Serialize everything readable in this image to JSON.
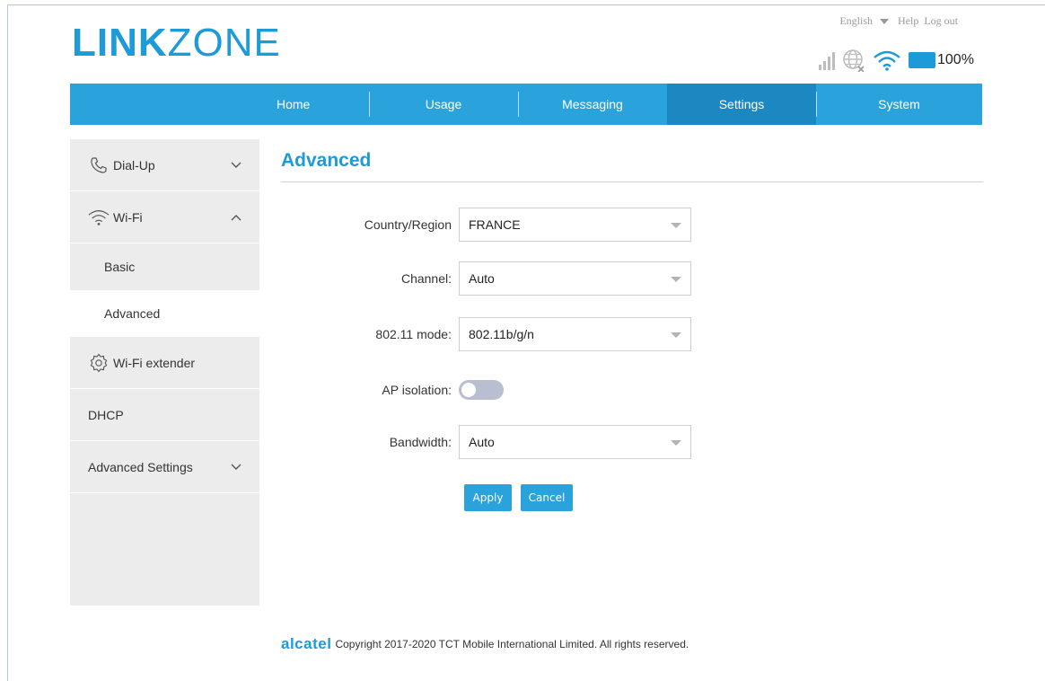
{
  "header": {
    "logo_bold": "LINK",
    "logo_light": "ZONE",
    "language": "English",
    "help": "Help",
    "logout": "Log out",
    "battery": "100%"
  },
  "nav": {
    "items": [
      {
        "label": "Home"
      },
      {
        "label": "Usage"
      },
      {
        "label": "Messaging"
      },
      {
        "label": "Settings",
        "active": true
      },
      {
        "label": "System"
      }
    ]
  },
  "sidebar": {
    "dialup": "Dial-Up",
    "wifi": "Wi-Fi",
    "wifi_basic": "Basic",
    "wifi_advanced": "Advanced",
    "wifi_extender": "Wi-Fi extender",
    "dhcp": "DHCP",
    "advanced_settings": "Advanced Settings"
  },
  "main": {
    "title": "Advanced",
    "country_label": "Country/Region",
    "country_value": "FRANCE",
    "channel_label": "Channel:",
    "channel_value": "Auto",
    "mode_label": "802.11 mode:",
    "mode_value": "802.11b/g/n",
    "ap_isolation_label": "AP isolation:",
    "ap_isolation_on": false,
    "bandwidth_label": "Bandwidth:",
    "bandwidth_value": "Auto",
    "apply": "Apply",
    "cancel": "Cancel"
  },
  "footer": {
    "brand": "alcatel",
    "copyright": "Copyright 2017-2020 TCT Mobile International Limited. All rights reserved."
  },
  "colors": {
    "accent": "#2aa3dc",
    "nav_active": "#1b88c2",
    "sidebar_bg": "#ececec"
  }
}
